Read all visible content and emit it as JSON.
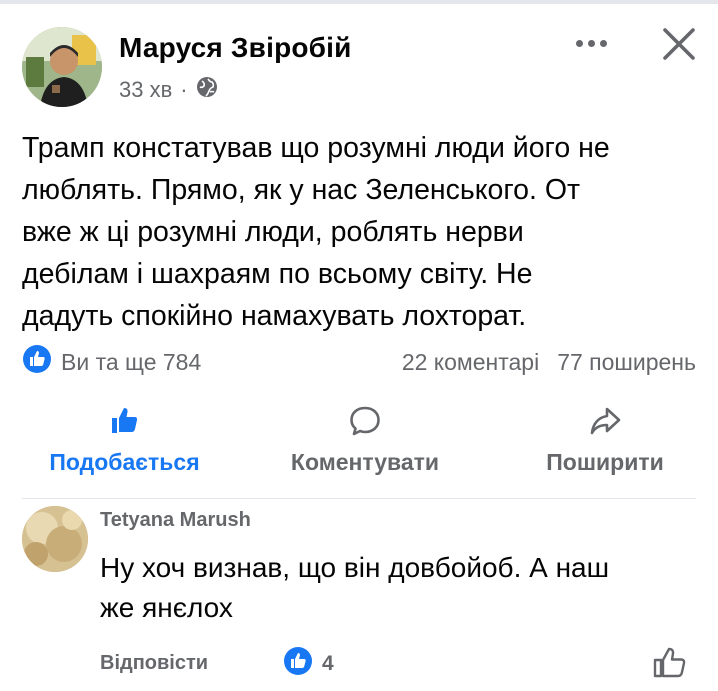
{
  "post": {
    "author": "Маруся Звіробій",
    "time": "33 хв",
    "separator": "·",
    "text": "Трамп констатував що розумні люди його не\nлюблять. Прямо, як у нас Зеленського. От\nвже ж ці розумні люди, роблять нерви\nдебілам і шахраям по всьому світу. Не\nдадуть спокійно намахувать лохторат.",
    "reactions": "Ви та ще 784",
    "comments": "22 коментарі",
    "shares": "77 поширень"
  },
  "actions": {
    "like": "Подобається",
    "comment": "Коментувати",
    "share": "Поширити"
  },
  "comment": {
    "author": "Tetyana Marush",
    "text": "Ну хоч визнав, що він довбойоб. А наш\nже янєлох",
    "reply": "Відповісти",
    "likes": "4"
  },
  "colors": {
    "accent": "#1877f2",
    "secondary_text": "#65676b",
    "primary_text": "#050505",
    "divider": "#e4e6eb"
  },
  "icons": {
    "globe": "globe-icon",
    "more": "more-options-icon",
    "close": "close-icon",
    "like": "thumbs-up-icon",
    "comment": "comment-bubble-icon",
    "share": "share-arrow-icon"
  }
}
